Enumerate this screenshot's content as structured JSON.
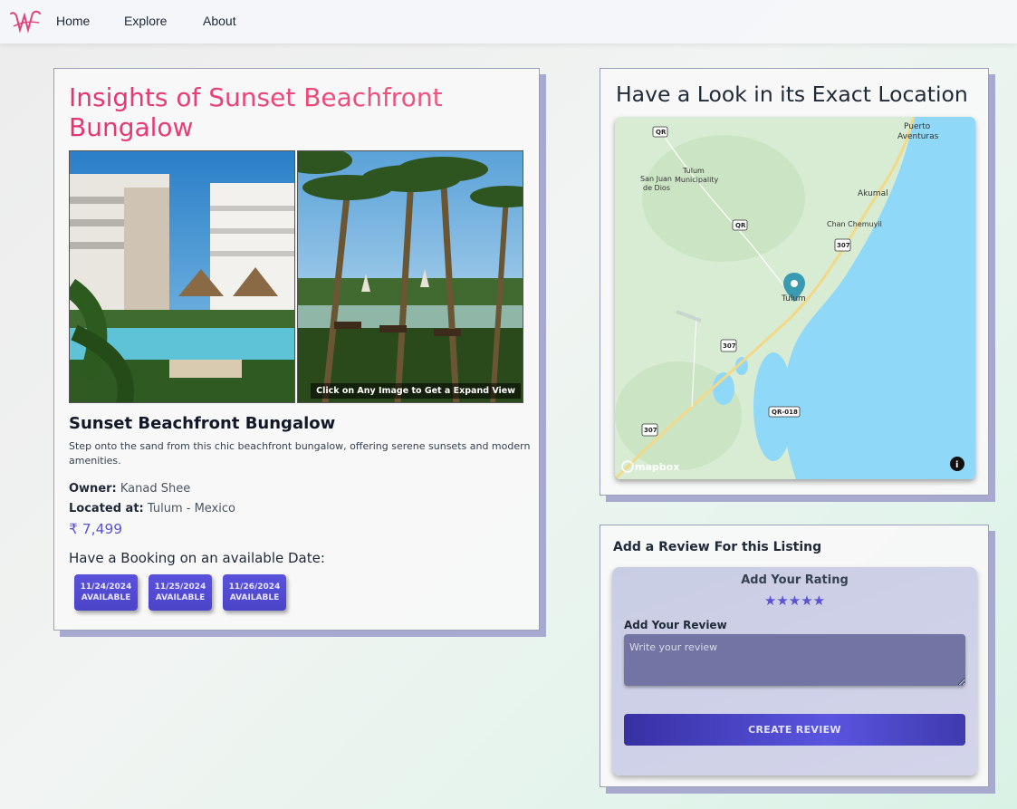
{
  "nav": {
    "logo": "logo-icon",
    "links": [
      "Home",
      "Explore",
      "About"
    ]
  },
  "listing": {
    "heading": "Insights of Sunset Beachfront Bungalow",
    "expand_hint": "Click on Any Image to Get a Expand View",
    "name": "Sunset Beachfront Bungalow",
    "description": "Step onto the sand from this chic beachfront bungalow, offering serene sunsets and modern amenities.",
    "owner_label": "Owner:",
    "owner": "Kanad Shee",
    "location_label": "Located at:",
    "location": "Tulum - Mexico",
    "price": "₹ 7,499",
    "booking_title": "Have a Booking on an available Date:",
    "dates": [
      {
        "date": "11/24/2024",
        "status": "AVAILABLE"
      },
      {
        "date": "11/25/2024",
        "status": "AVAILABLE"
      },
      {
        "date": "11/26/2024",
        "status": "AVAILABLE"
      }
    ]
  },
  "map": {
    "title": "Have a Look in its Exact Location",
    "labels": {
      "puerto": "Puerto",
      "aventuras": "Aventuras",
      "akumal": "Akumal",
      "chan_chemuyil": "Chan Chemuyil",
      "tulum_muni_1": "Tulum",
      "tulum_muni_2": "Municipality",
      "san_juan_1": "San Juan",
      "san_juan_2": "de Dios",
      "tulum": "Tulum",
      "qr1": "QR",
      "qr2": "QR",
      "r307a": "307",
      "r307b": "307",
      "r307c": "307",
      "qr018": "QR-018",
      "attribution": "mapbox"
    },
    "colors": {
      "water": "#8fd8f8",
      "land": "#d7ecd2",
      "road": "#f2d98a"
    }
  },
  "review": {
    "heading": "Add a Review For this Listing",
    "rating_label": "Add Your Rating",
    "stars": "★★★★★",
    "review_label": "Add Your Review",
    "placeholder": "Write your review",
    "button": "CREATE REVIEW"
  },
  "colors": {
    "accent": "#5b52d6",
    "title_pink": "#e6336f",
    "shadow": "#a7a9cf"
  }
}
